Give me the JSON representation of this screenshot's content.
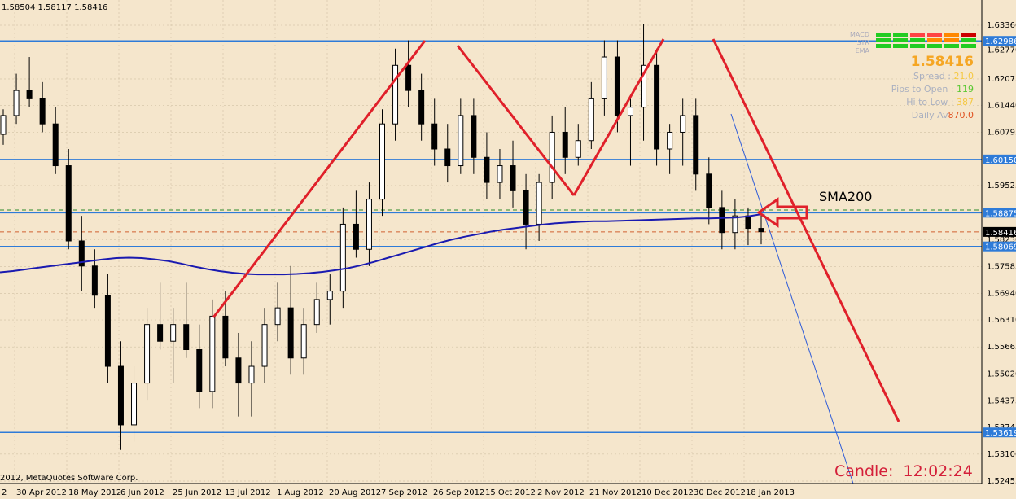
{
  "header": {
    "ohlc_text": "1.58504 1.58117 1.58416"
  },
  "footer": {
    "copyright": "2012, MetaQuotes Software Corp.",
    "candle_label": "Candle:",
    "candle_time": "12:02:24"
  },
  "annotations": {
    "sma_label": "SMA200"
  },
  "info_panel": {
    "indicator_labels": [
      "MACD",
      "STR",
      "EMA"
    ],
    "price": "1.58416",
    "spread_label": "Spread :",
    "spread_value": "21.0",
    "pips_label": "Pips to Open :",
    "pips_value": "119",
    "hilo_label": "Hi to Low :",
    "hilo_value": "387",
    "daily_label": "Daily Av",
    "daily_value": "870.0",
    "signal_colors": [
      [
        "#22cc22",
        "#22cc22",
        "#ff4444",
        "#ff4444",
        "#ff8800",
        "#cc0000"
      ],
      [
        "#22cc22",
        "#22cc22",
        "#22cc22",
        "#ff8800",
        "#ff8800",
        "#22cc22"
      ],
      [
        "#22cc22",
        "#22cc22",
        "#22cc22",
        "#22cc22",
        "#22cc22",
        "#22cc22"
      ]
    ]
  },
  "colors": {
    "background": "#f5e6cc",
    "bull_candle": "#ffffff",
    "bear_candle": "#000000",
    "sma": "#1a1ab0",
    "support_line": "#2e7bd8",
    "trend_red": "#e0202a",
    "grid": "#c8b89a"
  },
  "chart_data": {
    "type": "candlestick",
    "symbol_ohlc": "1.58504 1.58117 1.58416",
    "y_axis_ticks": [
      "1.63360",
      "1.62770",
      "1.62075",
      "1.61440",
      "1.60795",
      "1.60150",
      "1.59525",
      "1.58875",
      "1.58230",
      "1.57585",
      "1.56940",
      "1.56310",
      "1.55665",
      "1.55020",
      "1.54375",
      "1.53745",
      "1.53100",
      "1.52455"
    ],
    "x_axis_ticks": [
      "2",
      "30 Apr 2012",
      "18 May 2012",
      "6 Jun 2012",
      "25 Jun 2012",
      "13 Jul 2012",
      "1 Aug 2012",
      "20 Aug 2012",
      "7 Sep 2012",
      "26 Sep 2012",
      "15 Oct 2012",
      "2 Nov 2012",
      "21 Nov 2012",
      "10 Dec 2012",
      "30 Dec 2012",
      "18 Jan 2013"
    ],
    "horizontal_levels": [
      "1.62986",
      "1.60150",
      "1.58875",
      "1.58069",
      "1.53619"
    ],
    "current_price": "1.58416",
    "ylim": [
      1.52455,
      1.6336
    ],
    "sma200": [
      1.5745,
      1.5748,
      1.5752,
      1.5756,
      1.576,
      1.5764,
      1.5768,
      1.5772,
      1.5776,
      1.5779,
      1.578,
      1.5779,
      1.5776,
      1.5772,
      1.5766,
      1.5759,
      1.5753,
      1.5748,
      1.5744,
      1.5741,
      1.574,
      1.574,
      1.574,
      1.5741,
      1.5743,
      1.5746,
      1.575,
      1.5755,
      1.5762,
      1.577,
      1.5779,
      1.5788,
      1.5797,
      1.5806,
      1.5815,
      1.5823,
      1.583,
      1.5836,
      1.5842,
      1.5847,
      1.5851,
      1.5855,
      1.5859,
      1.5862,
      1.5864,
      1.5866,
      1.5867,
      1.5867,
      1.5868,
      1.5869,
      1.587,
      1.5871,
      1.5872,
      1.5873,
      1.5874,
      1.5874,
      1.5875,
      1.5876,
      1.5879,
      1.5884
    ],
    "candles": [
      [
        1.6075,
        1.6135,
        1.605,
        1.612
      ],
      [
        1.612,
        1.622,
        1.61,
        1.618
      ],
      [
        1.618,
        1.626,
        1.614,
        1.616
      ],
      [
        1.616,
        1.62,
        1.608,
        1.61
      ],
      [
        1.61,
        1.614,
        1.598,
        1.6
      ],
      [
        1.6,
        1.604,
        1.58,
        1.582
      ],
      [
        1.582,
        1.588,
        1.57,
        1.576
      ],
      [
        1.576,
        1.58,
        1.566,
        1.569
      ],
      [
        1.569,
        1.574,
        1.548,
        1.552
      ],
      [
        1.552,
        1.558,
        1.532,
        1.538
      ],
      [
        1.538,
        1.552,
        1.534,
        1.548
      ],
      [
        1.548,
        1.566,
        1.544,
        1.562
      ],
      [
        1.562,
        1.572,
        1.556,
        1.558
      ],
      [
        1.558,
        1.566,
        1.548,
        1.562
      ],
      [
        1.562,
        1.572,
        1.554,
        1.556
      ],
      [
        1.556,
        1.562,
        1.542,
        1.546
      ],
      [
        1.546,
        1.568,
        1.542,
        1.564
      ],
      [
        1.564,
        1.57,
        1.552,
        1.554
      ],
      [
        1.554,
        1.56,
        1.54,
        1.548
      ],
      [
        1.548,
        1.558,
        1.54,
        1.552
      ],
      [
        1.552,
        1.566,
        1.548,
        1.562
      ],
      [
        1.562,
        1.572,
        1.558,
        1.566
      ],
      [
        1.566,
        1.576,
        1.55,
        1.554
      ],
      [
        1.554,
        1.566,
        1.55,
        1.562
      ],
      [
        1.562,
        1.572,
        1.56,
        1.568
      ],
      [
        1.568,
        1.574,
        1.562,
        1.57
      ],
      [
        1.57,
        1.59,
        1.566,
        1.586
      ],
      [
        1.586,
        1.594,
        1.578,
        1.58
      ],
      [
        1.58,
        1.596,
        1.576,
        1.592
      ],
      [
        1.592,
        1.6135,
        1.588,
        1.61
      ],
      [
        1.61,
        1.628,
        1.606,
        1.624
      ],
      [
        1.624,
        1.63,
        1.614,
        1.618
      ],
      [
        1.618,
        1.622,
        1.606,
        1.61
      ],
      [
        1.61,
        1.616,
        1.6,
        1.604
      ],
      [
        1.604,
        1.61,
        1.596,
        1.6
      ],
      [
        1.6,
        1.616,
        1.598,
        1.612
      ],
      [
        1.612,
        1.616,
        1.598,
        1.602
      ],
      [
        1.602,
        1.608,
        1.592,
        1.596
      ],
      [
        1.596,
        1.604,
        1.592,
        1.6
      ],
      [
        1.6,
        1.606,
        1.59,
        1.594
      ],
      [
        1.594,
        1.598,
        1.58,
        1.586
      ],
      [
        1.586,
        1.598,
        1.582,
        1.596
      ],
      [
        1.596,
        1.612,
        1.592,
        1.608
      ],
      [
        1.608,
        1.614,
        1.598,
        1.602
      ],
      [
        1.602,
        1.61,
        1.6,
        1.606
      ],
      [
        1.606,
        1.62,
        1.604,
        1.616
      ],
      [
        1.616,
        1.63,
        1.612,
        1.626
      ],
      [
        1.626,
        1.63,
        1.608,
        1.612
      ],
      [
        1.612,
        1.616,
        1.6,
        1.614
      ],
      [
        1.614,
        1.634,
        1.606,
        1.624
      ],
      [
        1.624,
        1.628,
        1.6,
        1.604
      ],
      [
        1.604,
        1.61,
        1.598,
        1.608
      ],
      [
        1.608,
        1.616,
        1.6,
        1.612
      ],
      [
        1.612,
        1.616,
        1.594,
        1.598
      ],
      [
        1.598,
        1.602,
        1.586,
        1.59
      ],
      [
        1.59,
        1.594,
        1.58,
        1.584
      ],
      [
        1.584,
        1.592,
        1.58,
        1.588
      ],
      [
        1.588,
        1.59,
        1.581,
        1.585
      ],
      [
        1.585,
        1.5885,
        1.5812,
        1.5842
      ]
    ]
  }
}
